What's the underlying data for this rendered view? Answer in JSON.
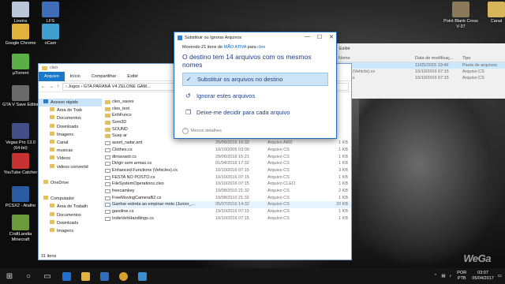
{
  "desktop_icons": [
    {
      "name": "lixeira",
      "label": "Lixeira",
      "color": "#b8c6d8"
    },
    {
      "name": "lfs",
      "label": "LFS",
      "color": "#3f6db8"
    },
    {
      "name": "google-chrome",
      "label": "Google Chrome",
      "color": "#e0b23a"
    },
    {
      "name": "ocam",
      "label": "oCam",
      "color": "#3fa0d0"
    },
    {
      "name": "utorrent",
      "label": "µTorrent",
      "color": "#5ab046"
    },
    {
      "name": "gta-v-save-editor",
      "label": "GTA V Save Editor",
      "color": "#6a6a6a"
    },
    {
      "name": "vegas-pro",
      "label": "Vegas Pro 13.0 (64-bit)",
      "color": "#444e88"
    },
    {
      "name": "youtube-catcher",
      "label": "YouTube Catcher",
      "color": "#c83232"
    },
    {
      "name": "pcsx2",
      "label": "PCSX2 - Atalho",
      "color": "#2a5aa0"
    },
    {
      "name": "craftlandia",
      "label": "CraftLandia Minecraft",
      "color": "#6a9a3a"
    },
    {
      "name": "point-blank",
      "label": "Point Blank Cross V-37",
      "color": "#8a7a5a"
    },
    {
      "name": "canal",
      "label": "Canal",
      "color": "#d8b45a"
    }
  ],
  "explorer": {
    "ribbon_tabs": [
      "Arquivo",
      "Início",
      "Compartilhar",
      "Exibir"
    ],
    "address": "›  Jogos  ›  GTA PARANÁ V4 ZELONE GAM...",
    "nav_items": [
      {
        "label": "Acesso rápido",
        "selected": true
      },
      {
        "label": "Área de Trab"
      },
      {
        "label": "Documentos"
      },
      {
        "label": "Downloads"
      },
      {
        "label": "Imagens"
      },
      {
        "label": "Canal"
      },
      {
        "label": "musicas"
      },
      {
        "label": "Vídeos"
      },
      {
        "label": "videos convertid"
      },
      {
        "label": ""
      },
      {
        "label": "OneDrive"
      },
      {
        "label": ""
      },
      {
        "label": "Computador"
      },
      {
        "label": "Área de Trabalh"
      },
      {
        "label": "Documentos"
      },
      {
        "label": "Downloads"
      },
      {
        "label": "Imagens"
      }
    ],
    "files": [
      {
        "name": "cleo_saves",
        "date": "",
        "type": "",
        "size": "",
        "folder": true
      },
      {
        "name": "cleo_text",
        "date": "",
        "type": "",
        "size": "",
        "folder": true
      },
      {
        "name": "EnhFuncs",
        "date": "",
        "type": "",
        "size": "",
        "folder": true
      },
      {
        "name": "Som3D",
        "date": "",
        "type": "",
        "size": "",
        "folder": true
      },
      {
        "name": "SOUND",
        "date": "30/07/2016 16:52",
        "type": "Pasta de arquivos",
        "size": "",
        "folder": true
      },
      {
        "name": "Susp ar",
        "date": "30/07/2016 16:52",
        "type": "Pasta de arquivos",
        "size": "",
        "folder": true
      },
      {
        "name": "asset_radar.ard",
        "date": "25/06/2016 16:32",
        "type": "Arquivo ARD",
        "size": "1 KB"
      },
      {
        "name": "Clothes.cs",
        "date": "10/10/2005 03:00",
        "type": "Arquivo CS",
        "size": "1 KB"
      },
      {
        "name": "dirnavastr.cs",
        "date": "29/06/2016 15:21",
        "type": "Arquivo CS",
        "size": "1 KB"
      },
      {
        "name": "Dirigir sem armas.cs",
        "date": "01/04/2016 17:32",
        "type": "Arquivo CS",
        "size": "1 KB"
      },
      {
        "name": "Enhanced Functions (Vehicles).cs",
        "date": "10/10/2016 07:15",
        "type": "Arquivo CS",
        "size": "3 KB"
      },
      {
        "name": "FESTA NO POSTO.cs",
        "date": "10/10/2016 07:15",
        "type": "Arquivo CS",
        "size": "1 KB"
      },
      {
        "name": "FileSystemOperations.cleo",
        "date": "10/10/2016 07:15",
        "type": "Arquivo CLEO",
        "size": "1 KB"
      },
      {
        "name": "freecamkey",
        "date": "19/08/2010 21:32",
        "type": "Arquivo CS",
        "size": "2 KB"
      },
      {
        "name": "FreeMovingCameraB2.cs",
        "date": "19/08/2010 21:32",
        "type": "Arquivo CS",
        "size": "1 KB"
      },
      {
        "name": "Ganhar estrela ao empinar moto (Junior_...",
        "date": "05/07/2016 14:32",
        "type": "Arquivo CS",
        "size": "20 KB",
        "highlight": true
      },
      {
        "name": "gasoline.cs",
        "date": "19/10/2016 07:15",
        "type": "Arquivo CS",
        "size": "1 KB"
      },
      {
        "name": "IndieVehHandlings.cs",
        "date": "10/10/2016 07:15",
        "type": "Arquivo CS",
        "size": "1 KB"
      }
    ],
    "status": "31 itens"
  },
  "bg_window": {
    "header": {
      "name": "Nome",
      "date": "Data de modificaç...",
      "type": "Tipo"
    },
    "rows": [
      {
        "name": "",
        "date": "11/05/2015 19:46",
        "type": "Pasta de arquivos",
        "selected": true
      },
      {
        "name": "...tions (Vehicle).cs",
        "date": "10/10/2016 07:15",
        "type": "Arquivo CS"
      },
      {
        "name": "...iger.cs",
        "date": "10/10/2016 07:15",
        "type": "Arquivo CS"
      }
    ],
    "label": "Exibir"
  },
  "dialog": {
    "title": "Substituir ou Ignorar Arquivos",
    "moving_prefix": "Movendo 21 itens de",
    "source": "MÃO ATIVA",
    "moving_mid": "para",
    "dest": "cleo",
    "heading": "O destino tem 14 arquivos com os mesmos nomes",
    "options": [
      {
        "label": "Substituir os arquivos no destino",
        "icon": "checkmark-icon",
        "selected": true
      },
      {
        "label": "Ignorar estes arquivos",
        "icon": "skip-icon",
        "selected": false
      },
      {
        "label": "Deixe-me decidir para cada arquivo",
        "icon": "decide-icon",
        "selected": false
      }
    ],
    "details": "Menos detalhes"
  },
  "taskbar": {
    "lang": "POR PTB",
    "time": "03:07",
    "date": "05/04/2017"
  },
  "watermark": "WeGa"
}
